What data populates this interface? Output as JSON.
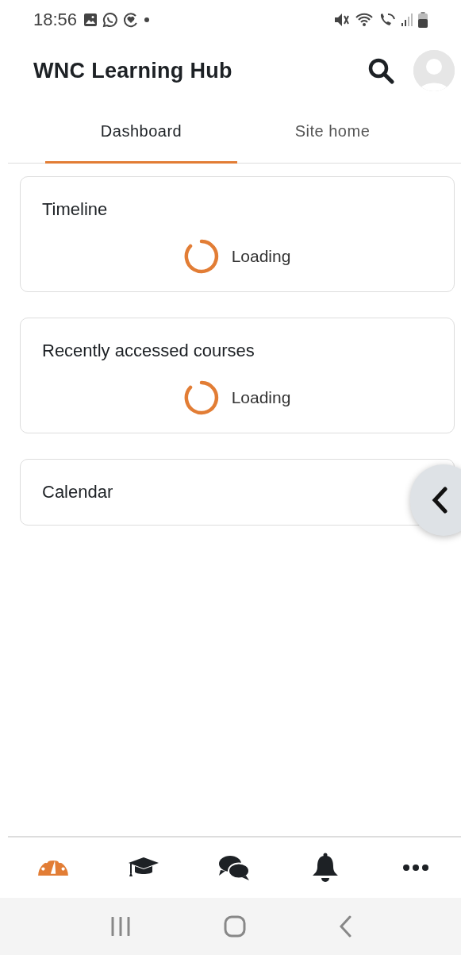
{
  "status_bar": {
    "time": "18:56"
  },
  "header": {
    "title": "WNC Learning Hub"
  },
  "tabs": [
    {
      "label": "Dashboard",
      "selected": true
    },
    {
      "label": "Site home",
      "selected": false
    }
  ],
  "blocks": [
    {
      "title": "Timeline",
      "loading_text": "Loading"
    },
    {
      "title": "Recently accessed courses",
      "loading_text": "Loading"
    },
    {
      "title": "Calendar"
    }
  ],
  "bottom_nav": [
    {
      "kind": "dashboard",
      "selected": true
    },
    {
      "kind": "courses",
      "selected": false
    },
    {
      "kind": "messages",
      "selected": false
    },
    {
      "kind": "notifications",
      "selected": false
    },
    {
      "kind": "more",
      "selected": false
    }
  ]
}
